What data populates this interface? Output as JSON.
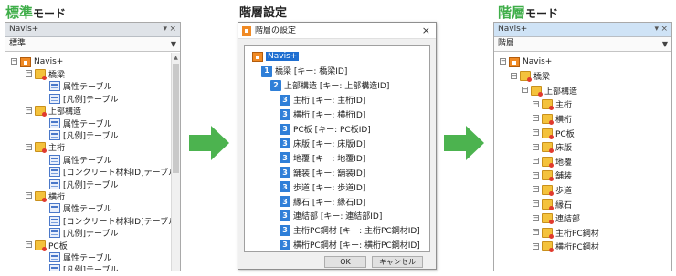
{
  "headings": {
    "standard": {
      "accent": "標準",
      "rest": "モード"
    },
    "settings": {
      "text": "階層設定"
    },
    "hierarchy": {
      "accent": "階層",
      "rest": "モード"
    }
  },
  "left_panel": {
    "title": "Navis+",
    "combo_value": "標準",
    "tree": [
      {
        "label": "Navis+",
        "icon": "app-icon",
        "level": 0
      },
      {
        "label": "橋梁",
        "icon": "folder-icon",
        "level": 1
      },
      {
        "label": "属性テーブル",
        "icon": "table-icon",
        "level": 2
      },
      {
        "label": "[凡例]テーブル",
        "icon": "table-icon",
        "level": 2
      },
      {
        "label": "上部構造",
        "icon": "folder-icon",
        "level": 1
      },
      {
        "label": "属性テーブル",
        "icon": "table-icon",
        "level": 2
      },
      {
        "label": "[凡例]テーブル",
        "icon": "table-icon",
        "level": 2
      },
      {
        "label": "主桁",
        "icon": "folder-icon",
        "level": 1
      },
      {
        "label": "属性テーブル",
        "icon": "table-icon",
        "level": 2
      },
      {
        "label": "[コンクリート材料ID]テーブル",
        "icon": "table-icon",
        "level": 2
      },
      {
        "label": "[凡例]テーブル",
        "icon": "table-icon",
        "level": 2
      },
      {
        "label": "横桁",
        "icon": "folder-icon",
        "level": 1
      },
      {
        "label": "属性テーブル",
        "icon": "table-icon",
        "level": 2
      },
      {
        "label": "[コンクリート材料ID]テーブル",
        "icon": "table-icon",
        "level": 2
      },
      {
        "label": "[凡例]テーブル",
        "icon": "table-icon",
        "level": 2
      },
      {
        "label": "PC板",
        "icon": "folder-icon",
        "level": 1
      },
      {
        "label": "属性テーブル",
        "icon": "table-icon",
        "level": 2
      },
      {
        "label": "[凡例]テーブル",
        "icon": "table-icon",
        "level": 2
      }
    ]
  },
  "dialog": {
    "title": "階層の設定",
    "close": "×",
    "ok": "OK",
    "cancel": "キャンセル",
    "tree": [
      {
        "label": "Navis+",
        "num": "",
        "level": 0
      },
      {
        "label": "橋梁 [キー: 橋梁ID]",
        "num": "1",
        "level": 1
      },
      {
        "label": "上部構造 [キー: 上部構造ID]",
        "num": "2",
        "level": 2
      },
      {
        "label": "主桁 [キー: 主桁ID]",
        "num": "3",
        "level": 3
      },
      {
        "label": "横桁 [キー: 横桁ID]",
        "num": "3",
        "level": 3
      },
      {
        "label": "PC板 [キー: PC板ID]",
        "num": "3",
        "level": 3
      },
      {
        "label": "床版 [キー: 床版ID]",
        "num": "3",
        "level": 3
      },
      {
        "label": "地覆 [キー: 地覆ID]",
        "num": "3",
        "level": 3
      },
      {
        "label": "舗装 [キー: 舗装ID]",
        "num": "3",
        "level": 3
      },
      {
        "label": "歩道 [キー: 歩道ID]",
        "num": "3",
        "level": 3
      },
      {
        "label": "縁石 [キー: 縁石ID]",
        "num": "3",
        "level": 3
      },
      {
        "label": "連結部 [キー: 連結部ID]",
        "num": "3",
        "level": 3
      },
      {
        "label": "主桁PC鋼材 [キー: 主桁PC鋼材ID]",
        "num": "3",
        "level": 3
      },
      {
        "label": "横桁PC鋼材 [キー: 横桁PC鋼材ID]",
        "num": "3",
        "level": 3
      }
    ]
  },
  "right_panel": {
    "title": "Navis+",
    "combo_value": "階層",
    "tree": [
      {
        "label": "Navis+",
        "icon": "app-icon",
        "level": 0
      },
      {
        "label": "橋梁",
        "icon": "folder-icon",
        "level": 1
      },
      {
        "label": "上部構造",
        "icon": "folder-icon",
        "level": 2
      },
      {
        "label": "主桁",
        "icon": "folder-icon",
        "level": 3
      },
      {
        "label": "横桁",
        "icon": "folder-icon",
        "level": 3
      },
      {
        "label": "PC板",
        "icon": "folder-icon",
        "level": 3
      },
      {
        "label": "床版",
        "icon": "folder-icon",
        "level": 3
      },
      {
        "label": "地覆",
        "icon": "folder-icon",
        "level": 3
      },
      {
        "label": "舗装",
        "icon": "folder-icon",
        "level": 3
      },
      {
        "label": "歩道",
        "icon": "folder-icon",
        "level": 3
      },
      {
        "label": "縁石",
        "icon": "folder-icon",
        "level": 3
      },
      {
        "label": "連結部",
        "icon": "folder-icon",
        "level": 3
      },
      {
        "label": "主桁PC鋼材",
        "icon": "folder-icon",
        "level": 3
      },
      {
        "label": "横桁PC鋼材",
        "icon": "folder-icon",
        "level": 3
      }
    ]
  },
  "colors": {
    "accent": "#3fae49",
    "number_badge": "#2f7fd8",
    "selection": "#1f6fd1"
  }
}
